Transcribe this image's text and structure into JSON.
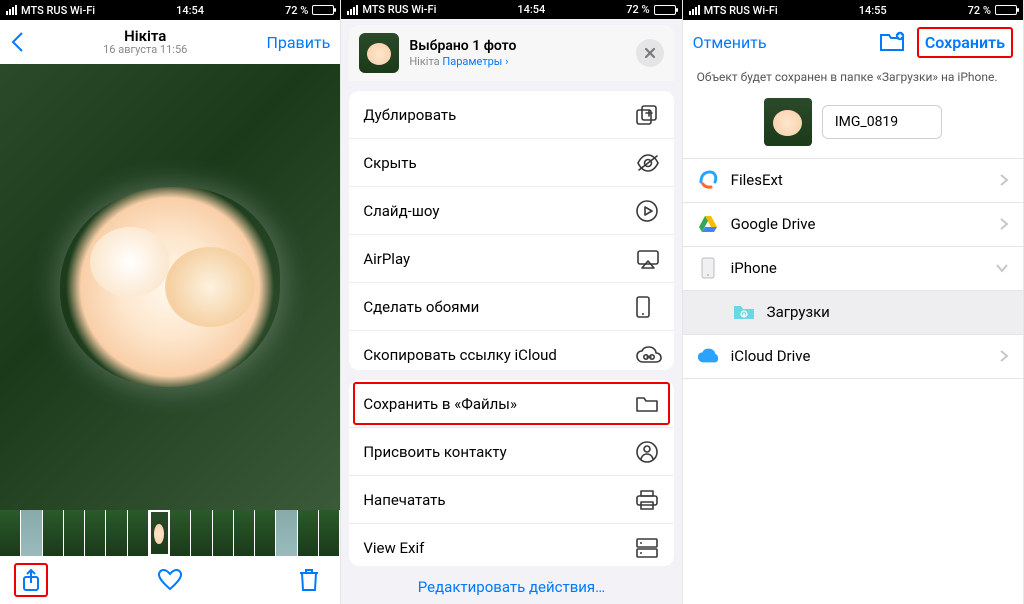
{
  "status": {
    "carrier": "MTS RUS Wi-Fi",
    "time1": "14:54",
    "time2": "14:54",
    "time3": "14:55",
    "battery": "72 %",
    "battery_fill": "72%"
  },
  "screen1": {
    "title": "Нікіта",
    "subtitle": "16 августа 11:56",
    "edit": "Править"
  },
  "screen2": {
    "selected_title": "Выбрано 1 фото",
    "selected_sub_name": "Нікіта",
    "selected_sub_params": "Параметры",
    "group1": [
      {
        "label": "Дублировать",
        "icon": "duplicate"
      },
      {
        "label": "Скрыть",
        "icon": "hide"
      },
      {
        "label": "Слайд-шоу",
        "icon": "play"
      },
      {
        "label": "AirPlay",
        "icon": "airplay"
      },
      {
        "label": "Сделать обоями",
        "icon": "wallpaper"
      },
      {
        "label": "Скопировать ссылку iCloud",
        "icon": "cloudlink"
      }
    ],
    "group2": [
      {
        "label": "Сохранить в «Файлы»",
        "icon": "folder",
        "hi": true
      },
      {
        "label": "Присвоить контакту",
        "icon": "contact"
      },
      {
        "label": "Напечатать",
        "icon": "print"
      },
      {
        "label": "View Exif",
        "icon": "exif"
      }
    ],
    "edit_actions": "Редактировать действия…"
  },
  "screen3": {
    "cancel": "Отменить",
    "save": "Сохранить",
    "message": "Объект будет сохранен в папке «Загрузки» на iPhone.",
    "filename": "IMG_0819",
    "locations": [
      {
        "label": "FilesExt",
        "icon": "filesext",
        "chev": "right"
      },
      {
        "label": "Google Drive",
        "icon": "gdrive",
        "chev": "right"
      },
      {
        "label": "iPhone",
        "icon": "iphone",
        "chev": "down"
      },
      {
        "label": "Загрузки",
        "icon": "downloads",
        "indent": true
      },
      {
        "label": "iCloud Drive",
        "icon": "icloud",
        "chev": "right"
      }
    ]
  }
}
